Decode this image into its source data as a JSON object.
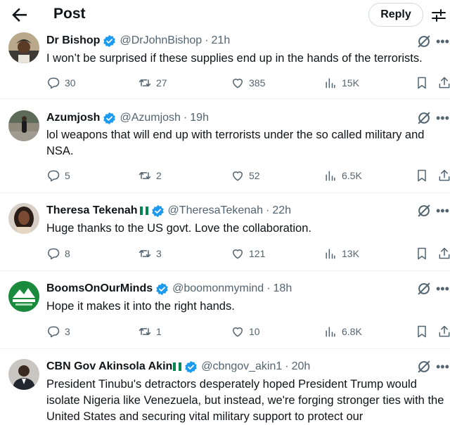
{
  "header": {
    "title": "Post",
    "reply_label": "Reply"
  },
  "icons": {
    "back": "arrow-left-icon",
    "adjust": "adjust-icon",
    "verified": "verified-badge-icon",
    "grok": "grok-icon",
    "more": "more-icon",
    "comment": "comment-icon",
    "repost": "repost-icon",
    "like": "heart-icon",
    "views": "views-icon",
    "bookmark": "bookmark-icon",
    "share": "share-icon"
  },
  "colors": {
    "verified": "#1d9bf0",
    "text": "#0f1419",
    "secondary": "#536471",
    "flag_green": "#008751"
  },
  "tweets": [
    {
      "name": "Dr Bishop",
      "handle": "@DrJohnBishop",
      "sep": "·",
      "time": "21h",
      "text": "I won’t be surprised if these supplies end up in the hands of the terrorists.",
      "replies": "30",
      "reposts": "27",
      "likes": "385",
      "views": "15K"
    },
    {
      "name": "Azumjosh",
      "handle": "@Azumjosh",
      "sep": "·",
      "time": "19h",
      "text": "lol weapons that will end up with terrorists under the so called military and NSA.",
      "replies": "5",
      "reposts": "2",
      "likes": "52",
      "views": "6.5K"
    },
    {
      "name": "Theresa Tekenah",
      "handle": "@TheresaTekenah",
      "sep": "·",
      "time": "22h",
      "text": "Huge thanks to the US govt. Love the collaboration.",
      "replies": "8",
      "reposts": "3",
      "likes": "121",
      "views": "13K"
    },
    {
      "name": "BoomsOnOurMinds",
      "handle": "@boomonmymind",
      "sep": "·",
      "time": "18h",
      "text": "Hope it makes it into the right hands.",
      "replies": "3",
      "reposts": "1",
      "likes": "10",
      "views": "6.8K"
    },
    {
      "name": "CBN Gov Akinsola Akin",
      "handle": "@cbngov_akin1",
      "sep": "·",
      "time": "20h",
      "text": "President Tinubu's detractors desperately hoped President Trump would isolate Nigeria like Venezuela, but instead, we're forging stronger ties with the United States and securing vital military support to protect our"
    }
  ]
}
